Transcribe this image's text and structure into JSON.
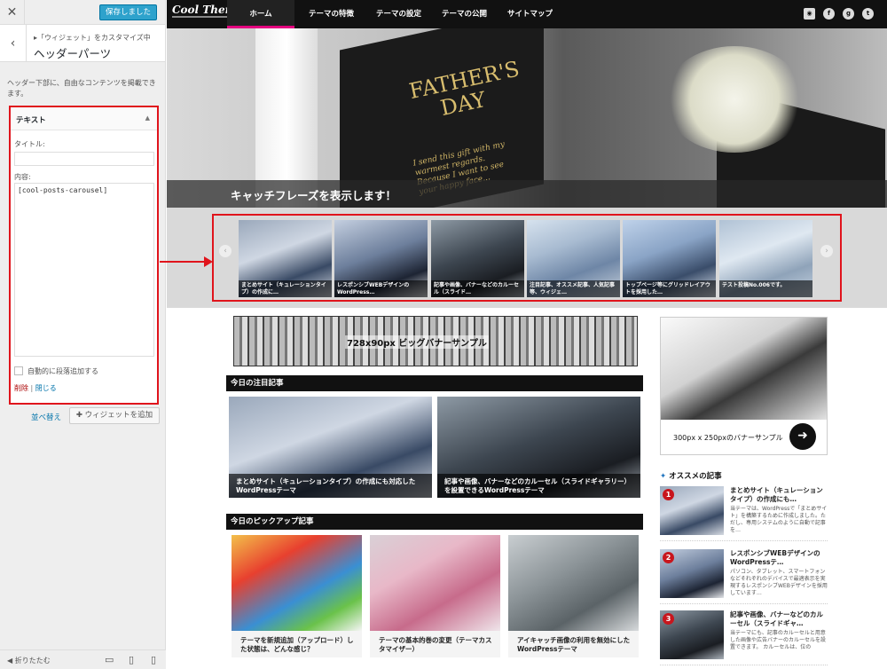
{
  "customizer": {
    "close_icon": "close-icon",
    "save_label": "保存しました",
    "breadcrumb": "「ウィジェット」をカスタマイズ中",
    "section_title": "ヘッダーパーツ",
    "description": "ヘッダー下部に、自由なコンテンツを掲載できます。",
    "widget": {
      "title": "テキスト",
      "title_label": "タイトル:",
      "title_value": "",
      "content_label": "内容:",
      "content_value": "[cool-posts-carousel]",
      "auto_paragraph_label": "自動的に段落追加する",
      "delete_label": "削除",
      "separator": "|",
      "close_label": "閉じる"
    },
    "reorder_label": "並べ替え",
    "add_widget_label": "ウィジェットを追加",
    "collapse_label": "折りたたむ"
  },
  "site": {
    "logo": "Cool Theme",
    "nav": [
      "ホーム",
      "テーマの特徴",
      "テーマの設定",
      "テーマの公開",
      "サイトマップ"
    ],
    "hero": {
      "title_line1": "FATHER'S",
      "title_line2": "DAY",
      "script_text": "I send this gift with my warmest regards. Because I want to see your happy face...",
      "catchphrase": "キャッチフレーズを表示します！"
    },
    "carousel": [
      "まとめサイト（キュレーションタイプ）の作成に…",
      "レスポンシブWEBデザインのWordPress…",
      "記事や画像、バナーなどのカルーセル（スライド…",
      "注目記事、オススメ記事、人気記事等、ウィジェ…",
      "トップページ等にグリッドレイアウトを採用した…",
      "テスト投稿No.006です。"
    ],
    "big_banner": "728x90px ビッグバナーサンプル",
    "featured_heading": "今日の注目記事",
    "featured": [
      "まとめサイト（キュレーションタイプ）の作成にも対応したWordPressテーマ",
      "記事や画像、バナーなどのカルーセル（スライドギャラリー）を設置できるWordPressテーマ"
    ],
    "pickup_heading": "今日のピックアップ記事",
    "pickup": [
      "テーマを新規追加（アップロード）した状態は、どんな感じ？",
      "テーマの基本的巻の変更（テーマカスタマイザー）",
      "アイキャッチ画像の利用を無効にしたWordPressテーマ"
    ],
    "side_banner": "300px x 250pxのバナーサンプル",
    "recommend_heading": "オススメの記事",
    "recommend": [
      {
        "num": "1",
        "title": "まとめサイト（キュレーションタイプ）の作成にも…",
        "excerpt": "当テーマは、WordPressで「まとめサイト」を構築するために作成しました。ただし、専用システムのように自動で記事を…"
      },
      {
        "num": "2",
        "title": "レスポンシブWEBデザインのWordPressテ…",
        "excerpt": "パソコン、タブレット、スマートフォンなどそれぞれのデバイスで最適表示を実現するレスポンシブWEBデザインを採用しています…"
      },
      {
        "num": "3",
        "title": "記事や画像、バナーなどのカルーセル（スライドギャ…",
        "excerpt": "当テーマにも、記事のカルーセルと用意した画像や広告バナーのカルーセルを設置できます。 カルーセルは、位の"
      }
    ]
  }
}
